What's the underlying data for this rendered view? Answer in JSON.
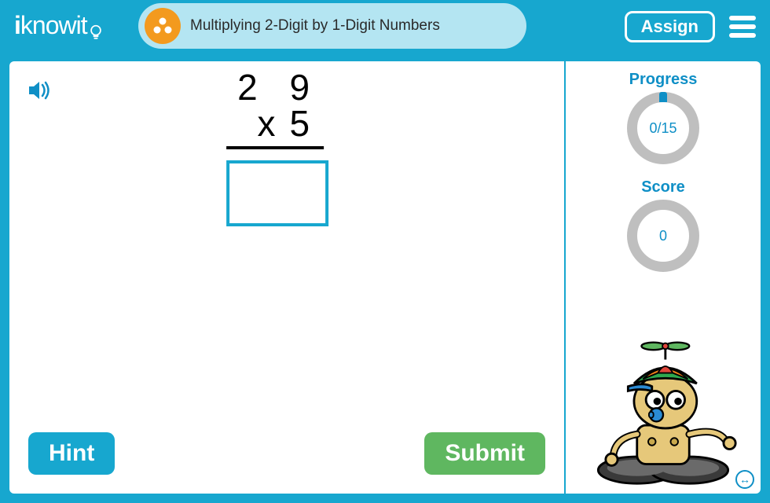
{
  "brand": {
    "name": "iknowit"
  },
  "header": {
    "lesson_title": "Multiplying 2-Digit by 1-Digit Numbers",
    "assign_label": "Assign"
  },
  "problem": {
    "top_number": "2 9",
    "operator": "x",
    "bottom_number": "5",
    "answer_value": ""
  },
  "buttons": {
    "hint_label": "Hint",
    "submit_label": "Submit"
  },
  "sidebar": {
    "progress_label": "Progress",
    "progress_text": "0/15",
    "score_label": "Score",
    "score_text": "0"
  }
}
